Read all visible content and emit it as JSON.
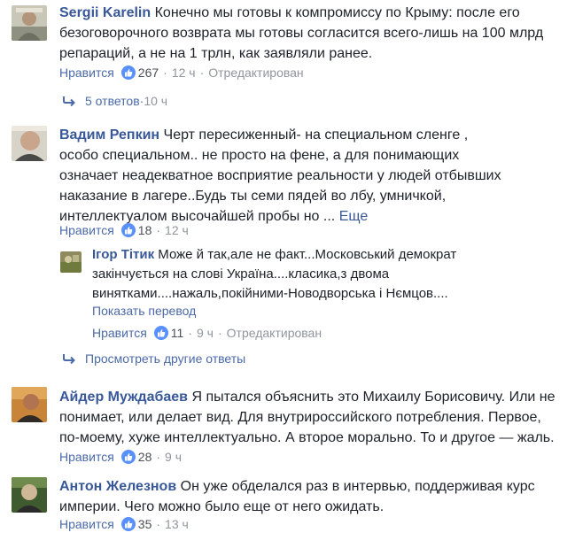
{
  "comments": [
    {
      "author": "Sergii Karelin",
      "text": "Конечно мы готовы к компромиссу по Крыму: после его безоговорочного возврата мы готовы согласится всего-лишь на 100 млрд репараций, а не на 1 трлн, как заявляли ранее.",
      "like_label": "Нравится",
      "likes": "267",
      "time": "12 ч",
      "edited": "Отредактирован",
      "replies_label": "5 ответов",
      "replies_time": "10 ч"
    },
    {
      "author": "Вадим Репкин",
      "text": "Черт пересиженный- на специальном сленге , особо специальном.. не просто на фене, а для понимающих означает неадекватное восприятие реальности у людей отбывших наказание в лагере..Будь ты семи пядей во лбу, умничкой, интеллектуалом высочайшей пробы но ...",
      "more": "Еще",
      "like_label": "Нравится",
      "likes": "18",
      "time": "12 ч",
      "reply": {
        "author": "Ігор Тітик",
        "text": "Може й так,але не факт...Московський демократ закінчується на слові Україна....класика,з двома винятками....нажаль,покійними-Новодворська і Нємцов....",
        "translate": "Показать перевод",
        "like_label": "Нравится",
        "likes": "11",
        "time": "9 ч",
        "edited": "Отредактирован"
      },
      "more_replies": "Просмотреть другие ответы"
    },
    {
      "author": "Айдер Муждабаев",
      "text": "Я пытался объяснить это Михаилу Борисовичу. Или не понимает, или делает вид. Для внутрироссийского потребления. Первое, по-моему, хуже интеллектуально. А второе морально. То и другое — жаль.",
      "like_label": "Нравится",
      "likes": "28",
      "time": "9 ч"
    },
    {
      "author": "Антон Железнов",
      "text": "Он уже обделался раз в интервью, поддерживая курс империи. Чего можно было еще от него ожидать.",
      "like_label": "Нравится",
      "likes": "35",
      "time": "13 ч"
    }
  ],
  "colors": {
    "link": "#385898",
    "meta": "#90949c",
    "like_badge": "#5890ff",
    "text": "#1d2129"
  },
  "icons": {
    "like": "thumbs-up-icon",
    "reply": "reply-arrow-icon"
  }
}
